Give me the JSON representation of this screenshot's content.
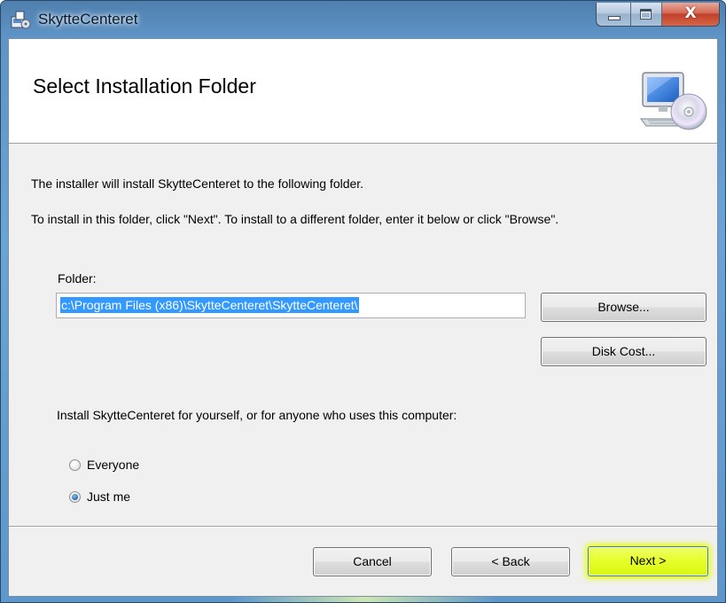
{
  "window": {
    "title": "SkytteCenteret",
    "caption_buttons": {
      "minimize": "minimize",
      "maximize": "maximize",
      "close": "X"
    }
  },
  "banner": {
    "title": "Select Installation Folder",
    "icon": "computer-disc-icon"
  },
  "body": {
    "intro_line": "The installer will install SkytteCenteret to the following folder.",
    "instruction_line": "To install in this folder, click \"Next\". To install to a different folder, enter it below or click \"Browse\".",
    "folder_label": "Folder:",
    "folder_value": "c:\\Program Files (x86)\\SkytteCenteret\\SkytteCenteret\\",
    "browse_label": "Browse...",
    "disk_cost_label": "Disk Cost...",
    "scope_question": "Install SkytteCenteret for yourself, or for anyone who uses this computer:",
    "options": [
      {
        "label": "Everyone",
        "checked": false
      },
      {
        "label": "Just me",
        "checked": true
      }
    ]
  },
  "footer": {
    "cancel_label": "Cancel",
    "back_label": "< Back",
    "next_label": "Next >"
  },
  "colors": {
    "title_bar": "#6aa4d6",
    "close_button": "#c1402a",
    "selection": "#3399ff",
    "next_highlight": "#e5ff28"
  }
}
